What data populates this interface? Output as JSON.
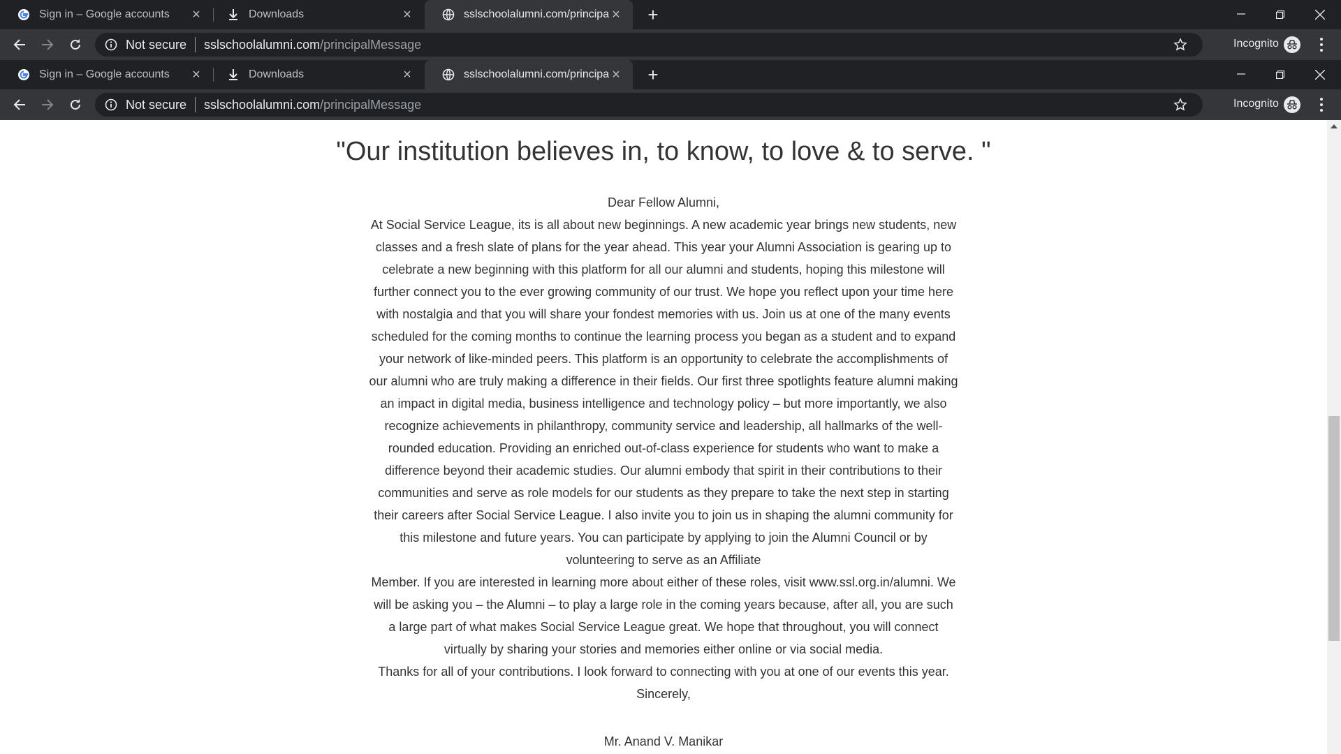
{
  "browser": {
    "tabs": [
      {
        "title": "Sign in – Google accounts",
        "icon": "google-icon",
        "active": false
      },
      {
        "title": "Downloads",
        "icon": "download-icon",
        "active": false
      },
      {
        "title": "sslschoolalumni.com/principalMessage",
        "icon": "globe-icon",
        "active": true
      }
    ],
    "security_label": "Not secure",
    "url_host": "sslschoolalumni.com",
    "url_path": "/principalMessage",
    "profile_label": "Incognito"
  },
  "page": {
    "headline": "\"Our institution believes in, to know, to love & to serve. \"",
    "greeting": "Dear Fellow Alumni,",
    "body_part1": "At Social Service League, its is all about new beginnings. A new academic year brings new students, new classes and a fresh slate of plans for the year ahead. This year your Alumni Association is gearing up to celebrate a new beginning with this platform for all our alumni and students, hoping this milestone will further connect you to the ever growing community of our trust. We hope you reflect upon your time here with nostalgia and that you will share your fondest memories with us. Join us at one of the many events scheduled for the coming months to continue the learning process you began as a student and to expand your network of like-minded peers. This platform is an opportunity to celebrate the accomplishments of our alumni who are truly making a difference in their fields. Our first three spotlights feature alumni making an impact in digital media, business intelligence and technology policy – but more importantly, we also recognize achievements in philanthropy, community service and leadership, all hallmarks of the well-rounded education. Providing an enriched out-of-class experience for students who want to make a difference beyond their academic studies. Our alumni embody that spirit in their contributions to their communities and serve as role models for our students as they prepare to take the next step in starting their careers after Social Service League. I also invite you to join us in shaping the alumni community for this milestone and future years. You can participate by applying to join the Alumni Council or by volunteering to serve as an Affiliate",
    "body_part2": "Member. If you are interested in learning more about either of these roles, visit www.ssl.org.in/alumni. We will be asking you – the Alumni – to play a large role in the coming years because, after all, you are such a large part of what makes Social Service League great. We hope that throughout, you will connect virtually by sharing your stories and memories either online or via social media.",
    "thanks": "Thanks for all of your contributions. I look forward to connecting with you at one of our events this year.",
    "closing": "Sincerely,",
    "signature": "Mr. Anand V. Manikar"
  }
}
